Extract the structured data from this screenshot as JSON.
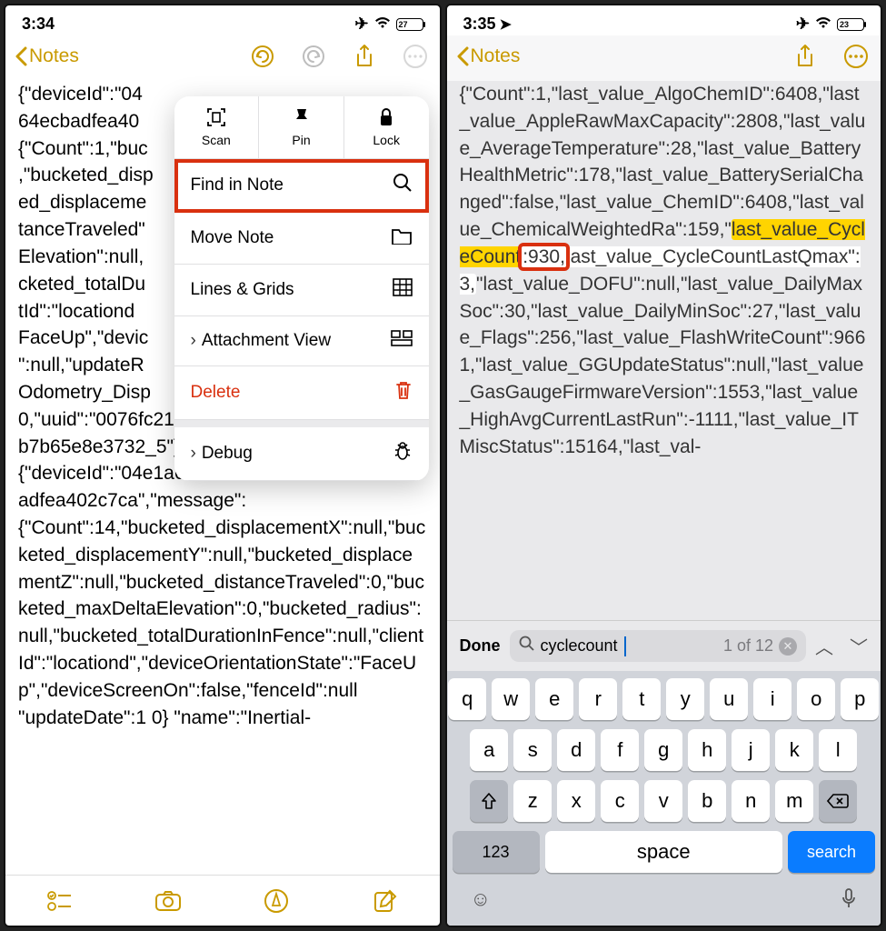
{
  "left": {
    "status": {
      "time": "3:34",
      "battery": "27"
    },
    "nav": {
      "back_label": "Notes"
    },
    "note_text": "{\"deviceId\":\"04\n64ecbadfea40\n{\"Count\":1,\"buc\n,\"bucketed_disp\ned_displaceme\ntanceTraveled\"\nElevation\":null,\ncketed_totalDu\ntId\":\"locationd\nFaceUp\",\"devic\n\":null,\"updateR\nOdometry_Disp\n0,\"uuid\":\"0076fc21-43a3-4053-9467-b7b65e8e3732_5\"}\n{\"deviceId\":\"04e1a642404d200313451a164ecbadfea402c7ca\",\"message\":{\"Count\":14,\"bucketed_displacementX\":null,\"bucketed_displacementY\":null,\"bucketed_displacementZ\":null,\"bucketed_distanceTraveled\":0,\"bucketed_maxDeltaElevation\":0,\"bucketed_radius\":null,\"bucketed_totalDurationInFence\":null,\"clientId\":\"locationd\",\"deviceOrientationState\":\"FaceUp\",\"deviceScreenOn\":false,\"fenceId\":null \"updateDate\":1 0} \"name\":\"Inertial-",
    "popup": {
      "scan": "Scan",
      "pin": "Pin",
      "lock": "Lock",
      "find": "Find in Note",
      "move": "Move Note",
      "lines": "Lines & Grids",
      "attachment": "Attachment View",
      "delete": "Delete",
      "debug": "Debug"
    }
  },
  "right": {
    "status": {
      "time": "3:35",
      "battery": "23"
    },
    "nav": {
      "back_label": "Notes"
    },
    "text_before": "{\"Count\":1,\"last_value_AlgoChemID\":6408,\"last_value_AppleRawMaxCapacity\":2808,\"last_value_AverageTemperature\":28,\"last_value_BatteryHealthMetric\":178,\"last_value_BatterySerialChanged\":false,\"last_value_ChemID\":6408,\"last_value_ChemicalWeightedRa\":159,\"",
    "highlight_key": "last_value_CycleCount",
    "highlight_val": ":930,",
    "text_after_hl": "last_value_CycleCountLastQmax\":3,",
    "text_rest": "\"last_value_DOFU\":null,\"last_value_DailyMaxSoc\":30,\"last_value_DailyMinSoc\":27,\"last_value_Flags\":256,\"last_value_FlashWriteCount\":9661,\"last_value_GGUpdateStatus\":null,\"last_value_GasGaugeFirmwareVersion\":1553,\"last_value_HighAvgCurrentLastRun\":-1111,\"last_value_ITMiscStatus\":15164,\"last_val-",
    "find": {
      "done": "Done",
      "query": "cyclecount",
      "count": "1 of 12"
    },
    "keyboard": {
      "row1": [
        "q",
        "w",
        "e",
        "r",
        "t",
        "y",
        "u",
        "i",
        "o",
        "p"
      ],
      "row2": [
        "a",
        "s",
        "d",
        "f",
        "g",
        "h",
        "j",
        "k",
        "l"
      ],
      "row3": [
        "z",
        "x",
        "c",
        "v",
        "b",
        "n",
        "m"
      ],
      "num": "123",
      "space": "space",
      "search": "search"
    }
  }
}
